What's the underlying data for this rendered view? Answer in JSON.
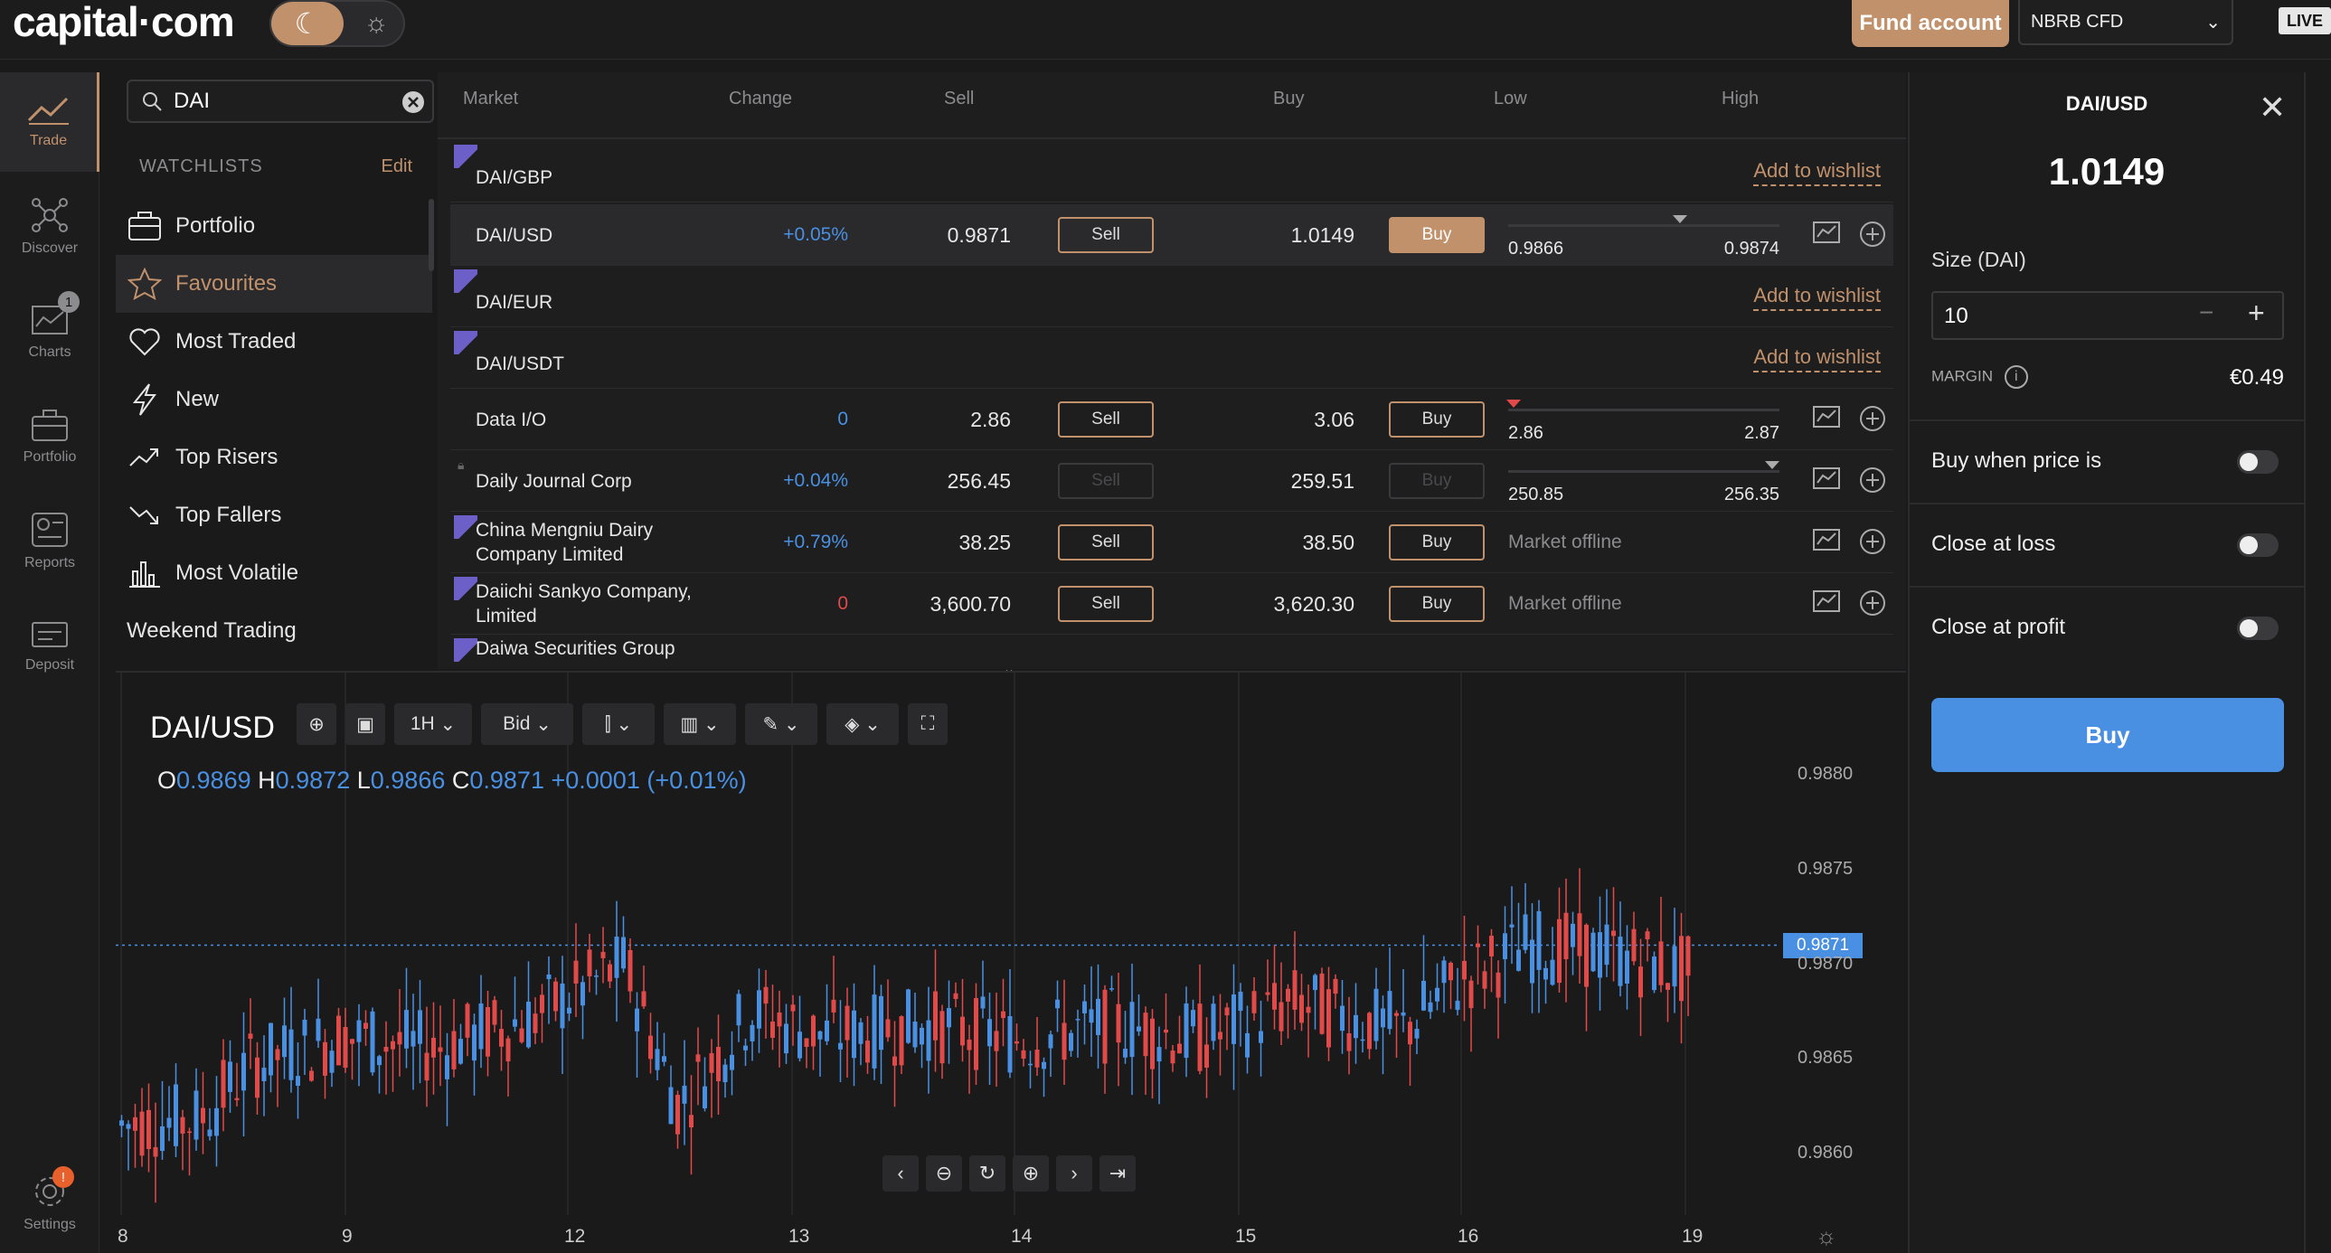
{
  "header": {
    "logo": "capital·com",
    "fund_button": "Fund account",
    "account": "NBRB CFD",
    "live_badge": "LIVE"
  },
  "colors": {
    "accent": "#c1916c",
    "buy_blue": "#4a90e2",
    "sell_red": "#e24a4a",
    "flag_purple": "#6c5fc7"
  },
  "nav": [
    {
      "label": "Trade",
      "icon": "trade-chart-icon"
    },
    {
      "label": "Discover",
      "icon": "discover-network-icon"
    },
    {
      "label": "Charts",
      "icon": "charts-icon",
      "badge": "1"
    },
    {
      "label": "Portfolio",
      "icon": "briefcase-icon"
    },
    {
      "label": "Reports",
      "icon": "reports-icon"
    },
    {
      "label": "Deposit",
      "icon": "deposit-icon"
    },
    {
      "label": "Settings",
      "icon": "gear-icon",
      "badge": "!"
    }
  ],
  "search": {
    "value": "DAI"
  },
  "watchlists": {
    "header": "WATCHLISTS",
    "edit": "Edit",
    "items": [
      {
        "label": "Portfolio",
        "icon": "briefcase-icon"
      },
      {
        "label": "Favourites",
        "icon": "star-icon"
      },
      {
        "label": "Most Traded",
        "icon": "heart-icon"
      },
      {
        "label": "New",
        "icon": "lightning-icon"
      },
      {
        "label": "Top Risers",
        "icon": "trend-up-icon"
      },
      {
        "label": "Top Fallers",
        "icon": "trend-down-icon"
      },
      {
        "label": "Most Volatile",
        "icon": "bar-chart-icon"
      },
      {
        "label": "Weekend Trading",
        "icon": ""
      }
    ]
  },
  "market": {
    "columns": [
      "Market",
      "Change",
      "Sell",
      "Buy",
      "Low",
      "High"
    ],
    "wishlist_label": "Add to wishlist",
    "rows": [
      {
        "name": "DAI/GBP",
        "type": "wishlist"
      },
      {
        "name": "DAI/USD",
        "change": "+0.05%",
        "sell": "0.9871",
        "sell_label": "Sell",
        "buy": "1.0149",
        "buy_label": "Buy",
        "low": "0.9866",
        "high": "0.9874"
      },
      {
        "name": "DAI/EUR",
        "type": "wishlist"
      },
      {
        "name": "DAI/USDT",
        "type": "wishlist"
      },
      {
        "name": "Data I/O",
        "change": "0",
        "sell": "2.86",
        "sell_label": "Sell",
        "buy": "3.06",
        "buy_label": "Buy",
        "low": "2.86",
        "high": "2.87"
      },
      {
        "name": "Daily Journal Corp",
        "change": "+0.04%",
        "sell": "256.45",
        "sell_label": "Sell",
        "buy": "259.51",
        "buy_label": "Buy",
        "low": "250.85",
        "high": "256.35"
      },
      {
        "name": "China Mengniu Dairy Company Limited",
        "change": "+0.79%",
        "sell": "38.25",
        "sell_label": "Sell",
        "buy": "38.50",
        "buy_label": "Buy",
        "offline": "Market offline"
      },
      {
        "name": "Daiichi Sankyo Company, Limited",
        "change": "0",
        "sell": "3,600.70",
        "sell_label": "Sell",
        "buy": "3,620.30",
        "buy_label": "Buy",
        "offline": "Market offline"
      },
      {
        "name": "Daiwa Securities Group"
      }
    ]
  },
  "chart": {
    "symbol": "DAI/USD",
    "interval": "1H",
    "price_type": "Bid",
    "ohlc": {
      "o_label": "O",
      "o": "0.9869",
      "h_label": "H",
      "h": "0.9872",
      "l_label": "L",
      "l": "0.9866",
      "c_label": "C",
      "c": "0.9871",
      "change": "+0.0001 (+0.01%)"
    },
    "current_price": "0.9871"
  },
  "chart_data": {
    "type": "candlestick",
    "x_ticks": [
      "8",
      "9",
      "12",
      "13",
      "14",
      "15",
      "16",
      "19"
    ],
    "y_ticks": [
      "0.9880",
      "0.9875",
      "0.9870",
      "0.9865",
      "0.9860"
    ],
    "ylim": [
      0.9857,
      0.9883
    ],
    "last": 0.9871,
    "series": []
  },
  "order": {
    "title": "DAI/USD",
    "price": "1.0149",
    "size_label": "Size (DAI)",
    "size_value": "10",
    "margin_label": "MARGIN",
    "margin_value": "€0.49",
    "buy_when": "Buy when price is",
    "close_loss": "Close at loss",
    "close_profit": "Close at profit",
    "buy_button": "Buy"
  }
}
